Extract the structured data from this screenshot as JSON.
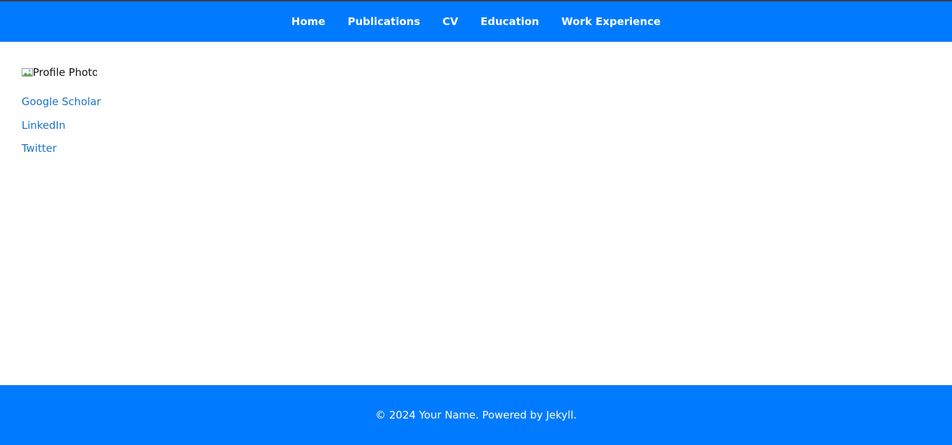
{
  "nav": {
    "items": [
      {
        "label": "Home"
      },
      {
        "label": "Publications"
      },
      {
        "label": "CV"
      },
      {
        "label": "Education"
      },
      {
        "label": "Work Experience"
      }
    ]
  },
  "sidebar": {
    "profile_photo_alt": "Profile Photo",
    "links": [
      {
        "label": "Google Scholar"
      },
      {
        "label": "LinkedIn"
      },
      {
        "label": "Twitter"
      }
    ]
  },
  "footer": {
    "text": "© 2024 Your Name. Powered by Jekyll."
  },
  "colors": {
    "accent": "#007bff",
    "link": "#1a73c8"
  }
}
